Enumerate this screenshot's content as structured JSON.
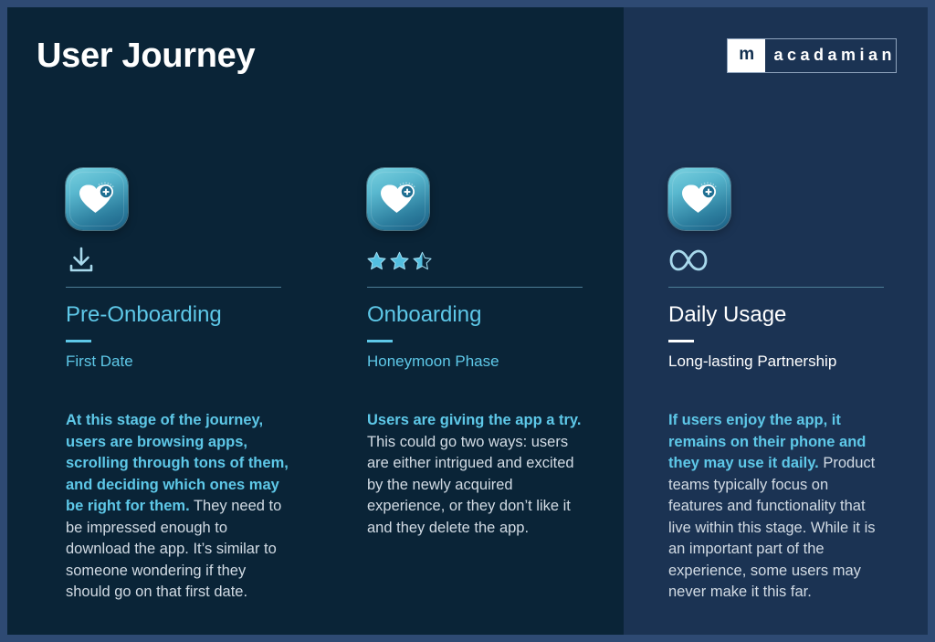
{
  "header": {
    "title": "User Journey",
    "logo": {
      "mark": "m",
      "word": "acadamian",
      "name": "macadamian"
    }
  },
  "theme": {
    "frame_border": "#2e4a73",
    "background": "#0a2437",
    "highlight_panel": "#1b3353",
    "accent": "#5ec8e8",
    "body_text": "#d2dbe4",
    "white": "#ffffff"
  },
  "columns": [
    {
      "icon": "app-icon-heart-plus",
      "glyph": "download-icon",
      "title": "Pre-Onboarding",
      "subtitle": "First Date",
      "title_color": "tint",
      "lead": "At this stage of the journey, users are browsing apps, scrolling through tons of them, and deciding which ones may be right for them.",
      "rest": "They need to be impressed enough to download the app. It’s similar to someone wondering if they should go on that first date."
    },
    {
      "icon": "app-icon-heart-plus",
      "glyph": "star-rating-icon",
      "rating": "2.5",
      "rating_max": "3",
      "title": "Onboarding",
      "subtitle": "Honeymoon Phase",
      "title_color": "tint",
      "lead": "Users are giving the app a try.",
      "rest": "This could go two ways: users are either intrigued and excited by the newly acquired experience, or they don’t like it and they delete the app."
    },
    {
      "icon": "app-icon-heart-plus",
      "glyph": "infinity-icon",
      "title": "Daily Usage",
      "subtitle": "Long-lasting Partnership",
      "title_color": "white",
      "lead": "If users enjoy the app, it remains on their phone and they may use it daily.",
      "rest": "Product teams typically focus on features and functionality that live within this stage. While it is an important part of the experience, some users may never make it this far."
    }
  ]
}
